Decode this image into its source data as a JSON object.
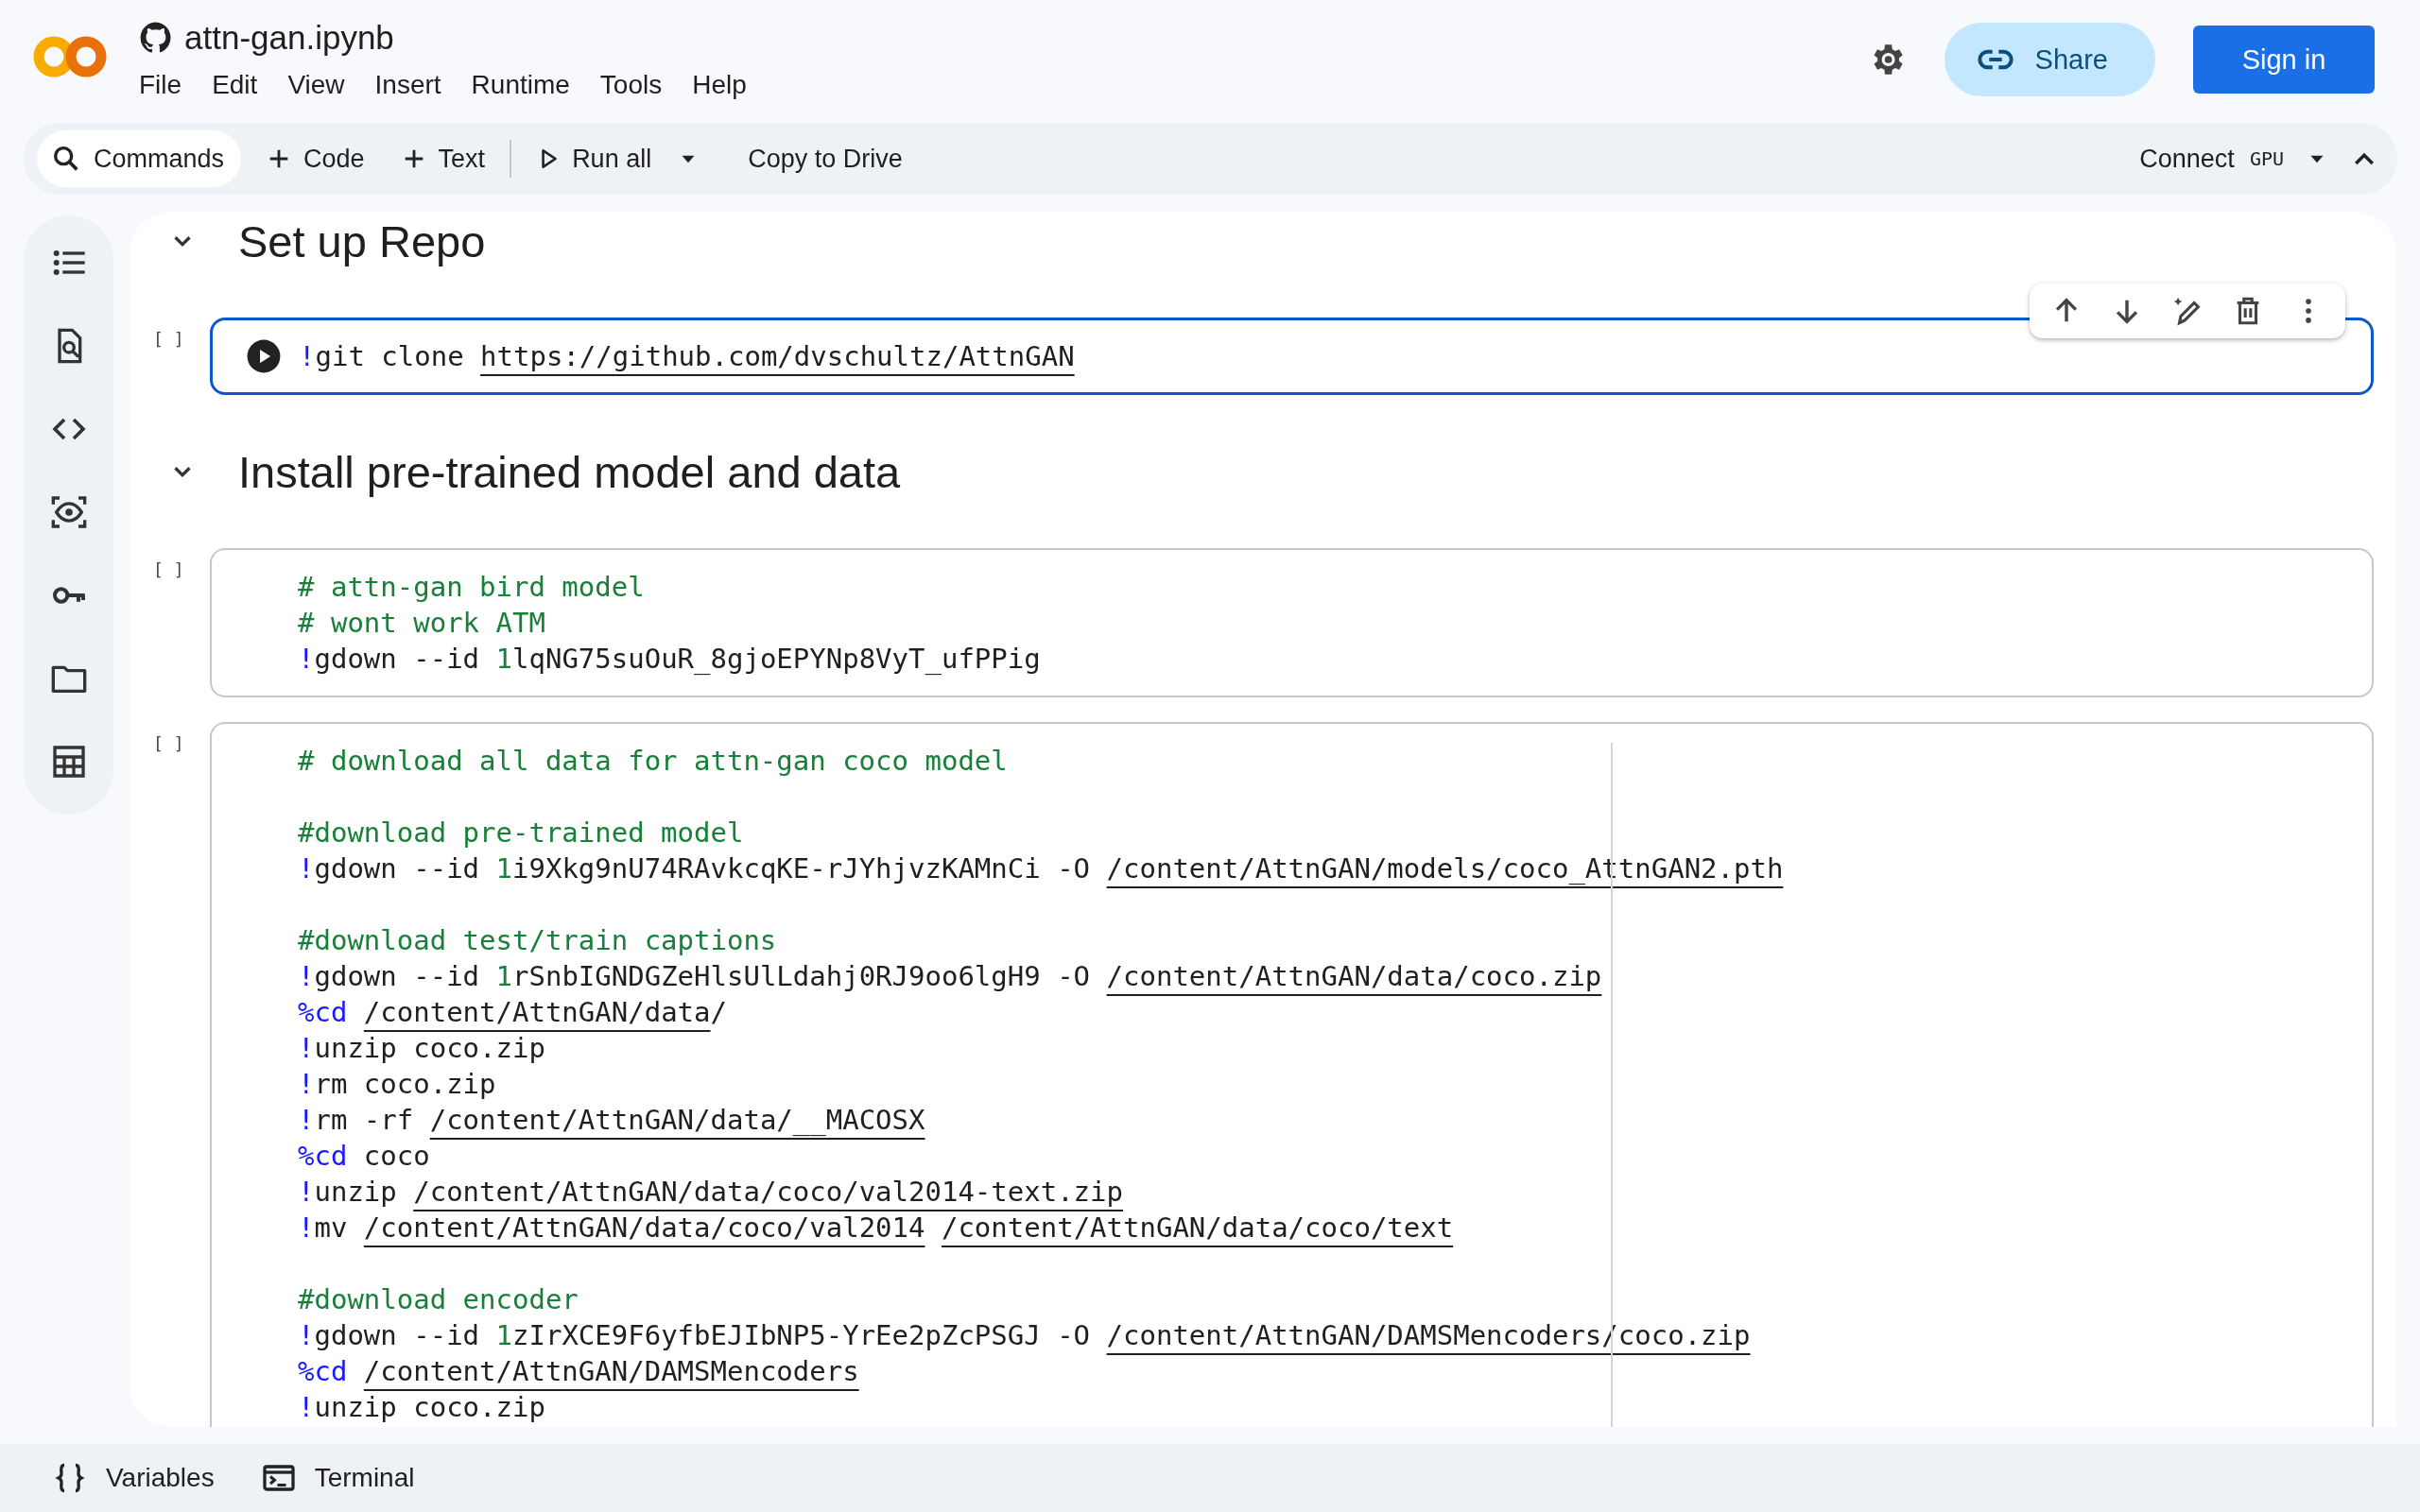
{
  "header": {
    "title": "attn-gan.ipynb",
    "menu": [
      "File",
      "Edit",
      "View",
      "Insert",
      "Runtime",
      "Tools",
      "Help"
    ],
    "share": "Share",
    "sign_in": "Sign in"
  },
  "toolbar": {
    "items": [
      {
        "kind": "search",
        "label": "Commands"
      },
      {
        "kind": "add",
        "label": "Code"
      },
      {
        "kind": "add",
        "label": "Text"
      },
      {
        "kind": "run",
        "label": "Run all"
      },
      {
        "kind": "menu"
      },
      {
        "kind": "plain",
        "label": "Copy to Drive"
      }
    ],
    "connect": "Connect",
    "badge": "GPU"
  },
  "notebook": [
    {
      "kind": "heading",
      "text": "Set up Repo",
      "expanded": true
    },
    {
      "kind": "code",
      "exec": "[ ]",
      "selected": true,
      "ruler": false,
      "blocks": [
        [
          [
            {
              "kind": "magic",
              "text": "!"
            },
            {
              "kind": "plain",
              "text": "git clone "
            },
            {
              "kind": "link",
              "text": "https://github.com/dvschultz/AttnGAN"
            }
          ]
        ]
      ]
    },
    {
      "kind": "heading",
      "text": "Install pre-trained model and data",
      "expanded": true
    },
    {
      "kind": "code",
      "exec": "[ ]",
      "selected": false,
      "ruler": false,
      "blocks": [
        [
          [
            {
              "kind": "comment",
              "text": "# attn-gan bird model"
            }
          ],
          [
            {
              "kind": "comment",
              "text": "# wont work ATM"
            }
          ],
          [
            {
              "kind": "magic",
              "text": "!"
            },
            {
              "kind": "plain",
              "text": "gdown --id "
            },
            {
              "kind": "number",
              "text": "1"
            },
            {
              "kind": "plain",
              "text": "lqNG75suOuR_8gjoEPYNp8VyT_ufPPig"
            }
          ]
        ]
      ]
    },
    {
      "kind": "code",
      "exec": "[ ]",
      "selected": false,
      "ruler": true,
      "blocks": [
        [
          [
            {
              "kind": "comment",
              "text": "# download all data for attn-gan coco model"
            }
          ]
        ],
        [
          [
            {
              "kind": "comment",
              "text": "#download pre-trained model"
            }
          ],
          [
            {
              "kind": "magic",
              "text": "!"
            },
            {
              "kind": "plain",
              "text": "gdown --id "
            },
            {
              "kind": "number",
              "text": "1"
            },
            {
              "kind": "plain",
              "text": "i9Xkg9nU74RAvkcqKE-rJYhjvzKAMnCi -O "
            },
            {
              "kind": "link",
              "text": "/content/AttnGAN/models/coco_AttnGAN2.pth"
            }
          ]
        ],
        [
          [
            {
              "kind": "comment",
              "text": "#download test/train captions"
            }
          ],
          [
            {
              "kind": "magic",
              "text": "!"
            },
            {
              "kind": "plain",
              "text": "gdown --id "
            },
            {
              "kind": "number",
              "text": "1"
            },
            {
              "kind": "plain",
              "text": "rSnbIGNDGZeHlsUlLdahj0RJ9oo6lgH9 -O "
            },
            {
              "kind": "link",
              "text": "/content/AttnGAN/data/coco.zip"
            }
          ],
          [
            {
              "kind": "magic",
              "text": "%cd"
            },
            {
              "kind": "gap"
            },
            {
              "kind": "link",
              "text": "/content/AttnGAN/data"
            },
            {
              "kind": "plain",
              "text": "/"
            }
          ],
          [
            {
              "kind": "magic",
              "text": "!"
            },
            {
              "kind": "plain",
              "text": "unzip coco.zip"
            }
          ],
          [
            {
              "kind": "magic",
              "text": "!"
            },
            {
              "kind": "plain",
              "text": "rm coco.zip"
            }
          ],
          [
            {
              "kind": "magic",
              "text": "!"
            },
            {
              "kind": "plain",
              "text": "rm -rf "
            },
            {
              "kind": "link",
              "text": "/content/AttnGAN/data/__MACOSX"
            }
          ],
          [
            {
              "kind": "magic",
              "text": "%cd"
            },
            {
              "kind": "plain",
              "text": " coco"
            }
          ],
          [
            {
              "kind": "magic",
              "text": "!"
            },
            {
              "kind": "plain",
              "text": "unzip "
            },
            {
              "kind": "link",
              "text": "/content/AttnGAN/data/coco/val2014-text.zip"
            }
          ],
          [
            {
              "kind": "magic",
              "text": "!"
            },
            {
              "kind": "plain",
              "text": "mv "
            },
            {
              "kind": "link",
              "text": "/content/AttnGAN/data/coco/val2014"
            },
            {
              "kind": "gap"
            },
            {
              "kind": "link",
              "text": "/content/AttnGAN/data/coco/text"
            }
          ]
        ],
        [
          [
            {
              "kind": "comment",
              "text": "#download encoder"
            }
          ],
          [
            {
              "kind": "magic",
              "text": "!"
            },
            {
              "kind": "plain",
              "text": "gdown --id "
            },
            {
              "kind": "number",
              "text": "1"
            },
            {
              "kind": "plain",
              "text": "zIrXCE9F6yfbEJIbNP5-YrEe2pZcPSGJ -O "
            },
            {
              "kind": "link",
              "text": "/content/AttnGAN/DAMSMencoders/coco.zip"
            }
          ],
          [
            {
              "kind": "magic",
              "text": "%cd"
            },
            {
              "kind": "gap"
            },
            {
              "kind": "link",
              "text": "/content/AttnGAN/DAMSMencoders"
            }
          ],
          [
            {
              "kind": "magic",
              "text": "!"
            },
            {
              "kind": "plain",
              "text": "unzip coco.zip"
            }
          ]
        ]
      ]
    }
  ],
  "bottom_bar": [
    {
      "kind": "variables",
      "label": "Variables"
    },
    {
      "kind": "terminal",
      "label": "Terminal"
    }
  ]
}
